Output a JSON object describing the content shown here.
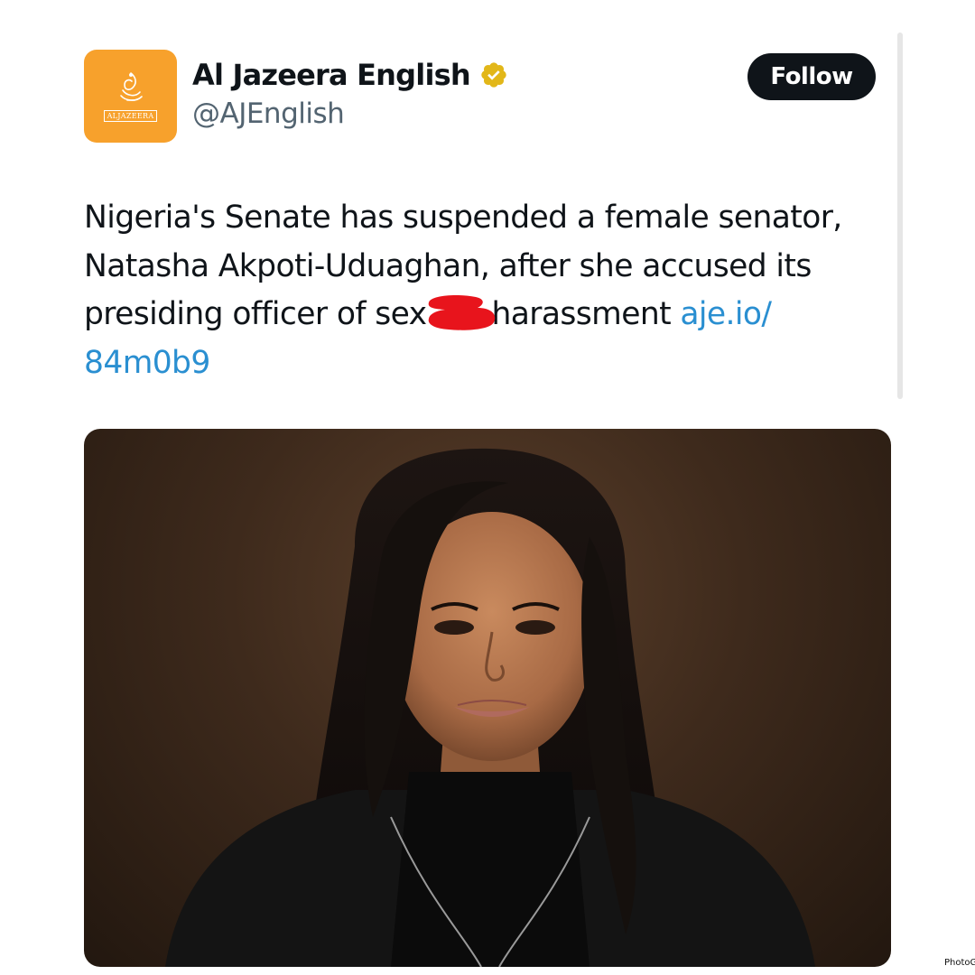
{
  "account": {
    "display_name": "Al Jazeera English",
    "handle": "@AJEnglish",
    "avatar_logo_text": "ALJAZEERA",
    "verified_icon": "verified-badge-icon",
    "brand_color": "#f7a12c"
  },
  "follow_button": {
    "label": "Follow"
  },
  "tweet": {
    "line1": "Nigeria's Senate has suspended a female senator,",
    "line2": "Natasha Akpoti-Uduaghan, after she accused its",
    "line3_before": "presiding officer of sex",
    "line3_after": "harassment ",
    "link_part1": "aje.io/",
    "link_part2": "84m0b9",
    "redaction_color": "#e8141c"
  },
  "media": {
    "description_icon": "portrait-photo"
  },
  "watermark": "PhotoG",
  "colors": {
    "text": "#0f1419",
    "secondary": "#536471",
    "link": "#2a8fd1",
    "button": "#0f1419"
  }
}
